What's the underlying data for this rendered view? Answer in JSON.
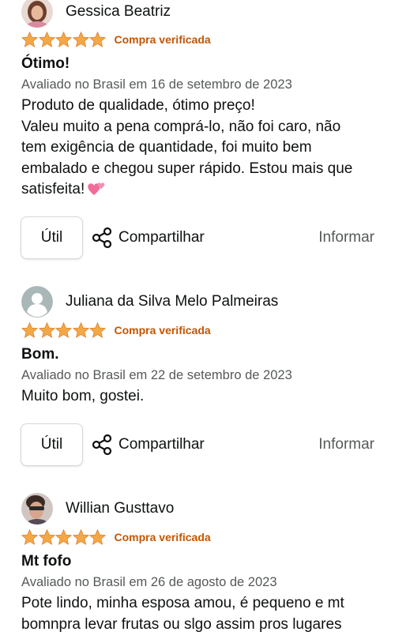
{
  "colors": {
    "star": "#f3a847",
    "verified": "#c45500",
    "secondary_text": "#565959",
    "button_border": "#d5d9d9"
  },
  "reviews": [
    {
      "reviewer": "Gessica Beatriz",
      "avatar": "profile-photo",
      "rating": 5,
      "verified_label": "Compra verificada",
      "title": "Ótimo!",
      "date": "Avaliado no Brasil em 16 de setembro de 2023",
      "body_lines": [
        "Produto de qualidade, ótimo preço!",
        "Valeu muito a pena comprá-lo, não foi caro, não",
        "tem exigência de quantidade, foi muito bem",
        "embalado e chegou super rápido. Estou mais que",
        "satisfeita!"
      ],
      "emoji": "two-hearts-icon",
      "helpful_label": "Útil",
      "share_label": "Compartilhar",
      "report_label": "Informar"
    },
    {
      "reviewer": "Juliana da Silva Melo Palmeiras",
      "avatar": "default-avatar",
      "rating": 5,
      "verified_label": "Compra verificada",
      "title": "Bom.",
      "date": "Avaliado no Brasil em 22 de setembro de 2023",
      "body_lines": [
        "Muito bom, gostei."
      ],
      "helpful_label": "Útil",
      "share_label": "Compartilhar",
      "report_label": "Informar"
    },
    {
      "reviewer": "Willian Gusttavo",
      "avatar": "profile-photo",
      "rating": 5,
      "verified_label": "Compra verificada",
      "title": "Mt fofo",
      "date": "Avaliado no Brasil em 26 de agosto de 2023",
      "body_lines": [
        "Pote lindo, minha esposa amou, é pequeno e mt",
        "bomnpra levar frutas ou slgo assim pros lugares"
      ]
    }
  ]
}
